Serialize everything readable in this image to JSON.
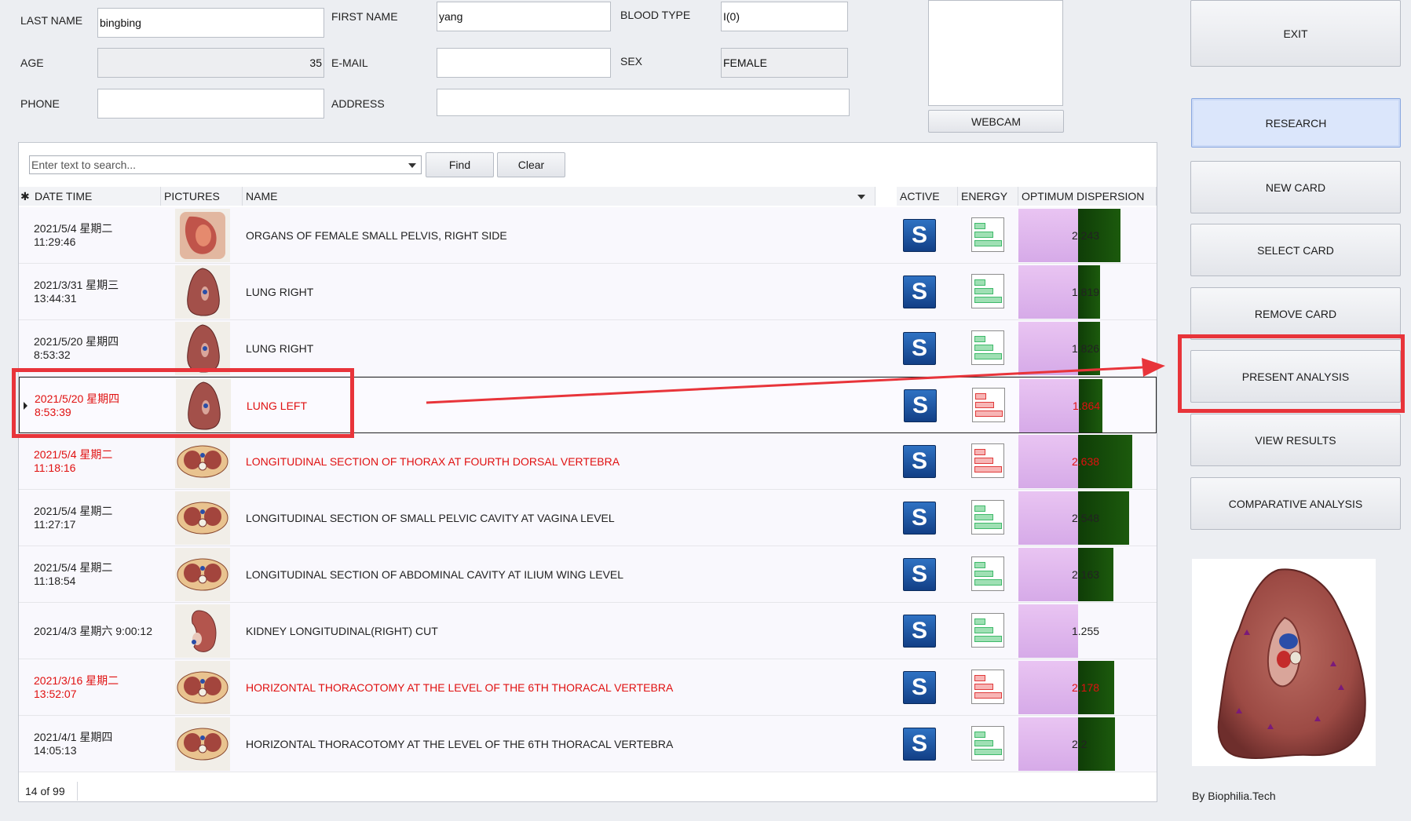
{
  "patient": {
    "last_name_label": "LAST NAME",
    "last_name": "bingbing",
    "first_name_label": "FIRST NAME",
    "first_name": "yang",
    "blood_type_label": "BLOOD TYPE",
    "blood_type": "I(0)",
    "age_label": "AGE",
    "age": "35",
    "email_label": "E-MAIL",
    "email": "",
    "sex_label": "SEX",
    "sex": "FEMALE",
    "phone_label": "PHONE",
    "phone": "",
    "address_label": "ADDRESS",
    "address": ""
  },
  "webcam": {
    "button_label": "WEBCAM"
  },
  "search": {
    "placeholder": "Enter text to search...",
    "find_label": "Find",
    "clear_label": "Clear"
  },
  "columns": {
    "marker": "✱",
    "datetime": "DATE TIME",
    "pictures": "PICTURES",
    "name": "NAME",
    "active": "ACTIVE",
    "energy": "ENERGY",
    "dispersion": "OPTIMUM DISPERSION"
  },
  "rows": [
    {
      "date": "2021/5/4 星期二",
      "time": "11:29:46",
      "name": "ORGANS OF FEMALE SMALL PELVIS, RIGHT SIDE",
      "value": "2.243",
      "dispersion_fraction": 0.55,
      "highlight": false,
      "current": false,
      "energy": "green",
      "picture": "pelvis-organs"
    },
    {
      "date": "2021/3/31 星期三",
      "time": "13:44:31",
      "name": "LUNG RIGHT",
      "value": "1.819",
      "dispersion_fraction": 0.28,
      "highlight": false,
      "current": false,
      "energy": "green",
      "picture": "lung"
    },
    {
      "date": "2021/5/20 星期四",
      "time": "8:53:32",
      "name": "LUNG RIGHT",
      "value": "1.826",
      "dispersion_fraction": 0.28,
      "highlight": false,
      "current": false,
      "energy": "green",
      "picture": "lung"
    },
    {
      "date": "2021/5/20 星期四",
      "time": "8:53:39",
      "name": "LUNG LEFT",
      "value": "1.864",
      "dispersion_fraction": 0.3,
      "highlight": true,
      "current": true,
      "energy": "red",
      "picture": "lung"
    },
    {
      "date": "2021/5/4 星期二",
      "time": "11:18:16",
      "name": "LONGITUDINAL SECTION OF THORAX AT FOURTH DORSAL VERTEBRA",
      "value": "2.638",
      "dispersion_fraction": 0.7,
      "highlight": true,
      "current": false,
      "energy": "red",
      "picture": "section"
    },
    {
      "date": "2021/5/4 星期二",
      "time": "11:27:17",
      "name": "LONGITUDINAL SECTION OF SMALL PELVIC CAVITY AT VAGINA LEVEL",
      "value": "2.548",
      "dispersion_fraction": 0.66,
      "highlight": false,
      "current": false,
      "energy": "green",
      "picture": "section"
    },
    {
      "date": "2021/5/4 星期二",
      "time": "11:18:54",
      "name": "LONGITUDINAL SECTION OF ABDOMINAL CAVITY AT ILIUM WING LEVEL",
      "value": "2.163",
      "dispersion_fraction": 0.45,
      "highlight": false,
      "current": false,
      "energy": "green",
      "picture": "section"
    },
    {
      "date": "2021/4/3 星期六 9:00:12",
      "time": "",
      "name": "KIDNEY LONGITUDINAL(RIGHT)  CUT",
      "value": "1.255",
      "dispersion_fraction": 0.0,
      "highlight": false,
      "current": false,
      "energy": "green",
      "picture": "kidney"
    },
    {
      "date": "2021/3/16 星期二",
      "time": "13:52:07",
      "name": "HORIZONTAL THORACOTOMY AT THE LEVEL OF THE 6TH THORACAL VERTEBRA",
      "value": "2.178",
      "dispersion_fraction": 0.46,
      "highlight": true,
      "current": false,
      "energy": "red",
      "picture": "section"
    },
    {
      "date": "2021/4/1 星期四",
      "time": "14:05:13",
      "name": "HORIZONTAL THORACOTOMY AT THE LEVEL OF THE 6TH THORACAL VERTEBRA",
      "value": "2.2",
      "dispersion_fraction": 0.47,
      "highlight": false,
      "current": false,
      "energy": "green",
      "picture": "section"
    }
  ],
  "footer": {
    "pager": "14 of 99"
  },
  "sidebar": {
    "exit": "EXIT",
    "research": "RESEARCH",
    "new_card": "NEW CARD",
    "select_card": "SELECT CARD",
    "remove_card": "REMOVE CARD",
    "present_analysis": "PRESENT ANALYSIS",
    "view_results": "VIEW RESULTS",
    "comparative_analysis": "COMPARATIVE ANALYSIS",
    "credit": "By Biophilia.Tech"
  },
  "colors": {
    "highlight_red": "#e01010",
    "annotation_red": "#e8343a",
    "selected_blue": "#dbe6fb"
  }
}
